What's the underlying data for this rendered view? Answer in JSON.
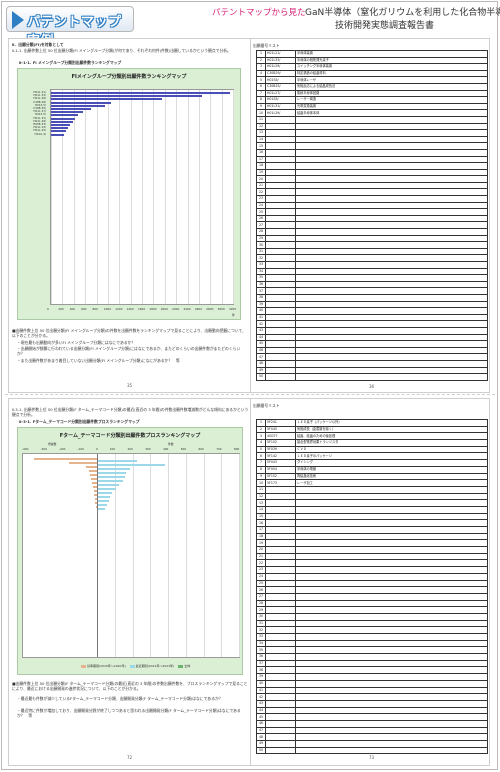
{
  "header": {
    "tag": "パテントマップ実例",
    "subtitle_pink": "パテントマップから見た",
    "title_line1": "GaN半導体（窒化ガリウムを利用した化合物半導体）",
    "title_line2": "技術開発実態調査報告書"
  },
  "top_left": {
    "section": "Ⅱ．出願分類(FI)を対象として",
    "heading1": "Ⅱ-1-1. 出願件数上位 50 位出願分類(FI メイングループ分類)が何であり、それぞれ何件(件数)出願しているかという観点で分析。",
    "heading2": "Ⅱ-1-1. FI メイングループ分類別出願件数ランキングマップ",
    "notes": [
      "■出願件数上位 50 位出願分類(FI メイングループ分類)の件数を出願件数をランキングマップで見ることにより、出願動向把握について、以下のことが分かる。",
      "・現在最も出願動向が多いFI メイングループ分類にはなにであるか？",
      "・出願開始が頻繁に行われている出願分類(FI メイングループ分類)にはなにであるか、またどのくらいの出願件数がまたどのくらいか？",
      "・また出願件数があまり着目していない出願分類(FI メイングループ分類)になにがあるか？　等"
    ],
    "page": "35"
  },
  "top_right": {
    "table_title": "出願番号リスト",
    "page": "36",
    "rows": [
      {
        "no": "1",
        "code": "H01L21/",
        "label": "半導体装置"
      },
      {
        "no": "2",
        "code": "H01L33/",
        "label": "半導体の個別発光素子"
      },
      {
        "no": "3",
        "code": "H01L29/",
        "label": "スイッチング半導体装置"
      },
      {
        "no": "4",
        "code": "C30B29/",
        "label": "特定構造の結晶材料"
      },
      {
        "no": "5",
        "code": "H01S5/",
        "label": "半導体レーザ"
      },
      {
        "no": "6",
        "code": "C30B25/",
        "label": "気相反応による結晶成長法"
      },
      {
        "no": "7",
        "code": "H01L27/",
        "label": "集積半導体回路"
      },
      {
        "no": "8",
        "code": "H01S5/",
        "label": "レーザー構造"
      },
      {
        "no": "9",
        "code": "H01L31/",
        "label": "光電変換装置"
      },
      {
        "no": "10",
        "code": "H01L29/",
        "label": "結晶半導体本体"
      }
    ],
    "extra_numbers": [
      "11",
      "12",
      "13",
      "14",
      "15",
      "16",
      "17",
      "18",
      "19",
      "20",
      "21",
      "22",
      "23",
      "24",
      "25",
      "26",
      "27",
      "28",
      "29",
      "30",
      "31",
      "32",
      "33",
      "34",
      "35",
      "36",
      "37",
      "38",
      "39",
      "40",
      "41",
      "42",
      "43",
      "44",
      "45",
      "46",
      "47",
      "48",
      "49",
      "50"
    ]
  },
  "chart_top": {
    "title": "FIメイングループ分類別出願件数ランキングマップ",
    "x_ticks": [
      "0",
      "200",
      "400",
      "600",
      "800",
      "1000",
      "1200",
      "1400",
      "1600",
      "1800",
      "2000",
      "2200",
      "2400",
      "2600",
      "2800",
      "3000",
      "3200"
    ],
    "x_unit": "件"
  },
  "chart_data": [
    {
      "type": "bar",
      "title": "FIメイングループ分類別出願件数ランキングマップ",
      "orientation": "horizontal",
      "categories": [
        "H01L 21/",
        "H01L 33/",
        "H01L 29/",
        "C30B 29/",
        "H01S 5/",
        "C30B 25/",
        "H01L 27/",
        "H01S 5/",
        "H01L 31/",
        "H01L 29/",
        "H05B 33/",
        "H01L 23/",
        "H01L 25/",
        "H01G 4/"
      ],
      "values": [
        3150,
        2650,
        1950,
        1050,
        950,
        700,
        560,
        480,
        420,
        380,
        330,
        300,
        260,
        230
      ],
      "xlim": [
        0,
        3200
      ]
    },
    {
      "type": "bar",
      "title": "Fターム_テーマコード分類別出願件数プロスランキングマップ",
      "orientation": "horizontal-diverging",
      "series": [
        {
          "name": "基準期間(2016年～2020年)",
          "color": "#e5b48c",
          "values": [
            340,
            150,
            60,
            45,
            40,
            30,
            25,
            20,
            18,
            15,
            12,
            10,
            8
          ]
        },
        {
          "name": "最近期間(2021年～2023年)",
          "color": "#9bd8e8",
          "values": [
            220,
            380,
            180,
            160,
            150,
            140,
            120,
            100,
            80,
            70,
            60,
            50,
            40
          ]
        }
      ],
      "xlim": [
        -400,
        800
      ]
    }
  ],
  "bottom_left": {
    "heading1": "Ⅱ-3-1. 出願件数上位 50 位出願分類(F ターム_テーマコード分類)の最近(直近の 3 年間)の件数出願件数増減数がどんな傾向にあるかという観点で分析。",
    "heading2": "Ⅱ-3-1. Fターム_テーマコード分類別出願件数プロスランキングマップ",
    "notes": [
      "■出願件数上位 50 位出願分類(F ターム_テーマコード分類)の最近(直近の 3 年間)の件数出願件数を、プロスランキングマップで見ることにより、最近における出願開発の進捗状況について、以下のことが分かる。",
      "・最近最も件数が減少しているFターム_テーマコード分類、出願開発分類(F ターム_テーマコード分類)はなにであるか？",
      "・最近特に件数が増加しており、出願開発分野が終了しつつあると思われる出願開発分類(F ターム_テーマコード分類)はなにであるか？　等"
    ],
    "page": "72"
  },
  "chart_bottom": {
    "title": "Fターム_テーマコード分類別出願件数プロスランキングマップ",
    "left_label": "増減数",
    "right_label": "件数",
    "left_ticks": [
      "-400",
      "-300",
      "-200",
      "-100",
      "0"
    ],
    "right_ticks": [
      "100",
      "200",
      "300",
      "400",
      "500",
      "600",
      "700",
      "800"
    ],
    "legend": [
      "基準期間(2016年～2020年)",
      "最近期間(2021年～2023年)",
      "全体"
    ]
  },
  "bottom_right": {
    "table_title": "出願番号リスト",
    "page": "73",
    "rows": [
      {
        "no": "1",
        "code": "5F241",
        "label": "ＬＥＤ素子（パッケージ以外）"
      },
      {
        "no": "2",
        "code": "5F045",
        "label": "気相成長（金属層を除く）"
      },
      {
        "no": "3",
        "code": "4G077",
        "label": "結晶、結晶のための後処理"
      },
      {
        "no": "4",
        "code": "5F102",
        "label": "接合型電界効果トランジスタ"
      },
      {
        "no": "5",
        "code": "5F039",
        "label": "ＣＶＤ"
      },
      {
        "no": "6",
        "code": "5F142",
        "label": "ＬＥＤ素子のパッケージ"
      },
      {
        "no": "7",
        "code": "5F043",
        "label": "ダイシング"
      },
      {
        "no": "8",
        "code": "5F004",
        "label": "半導体の電極"
      },
      {
        "no": "9",
        "code": "5F152",
        "label": "再結晶化技術"
      },
      {
        "no": "10",
        "code": "5F173",
        "label": "レーザ加工"
      }
    ],
    "extra_numbers": [
      "11",
      "12",
      "13",
      "14",
      "15",
      "16",
      "17",
      "18",
      "19",
      "20",
      "21",
      "22",
      "23",
      "24",
      "25",
      "26",
      "27",
      "28",
      "29",
      "30",
      "31",
      "32",
      "33",
      "34",
      "35",
      "36",
      "37",
      "38",
      "39",
      "40",
      "41",
      "42",
      "43",
      "44",
      "45",
      "46",
      "47",
      "48",
      "49",
      "50"
    ]
  }
}
